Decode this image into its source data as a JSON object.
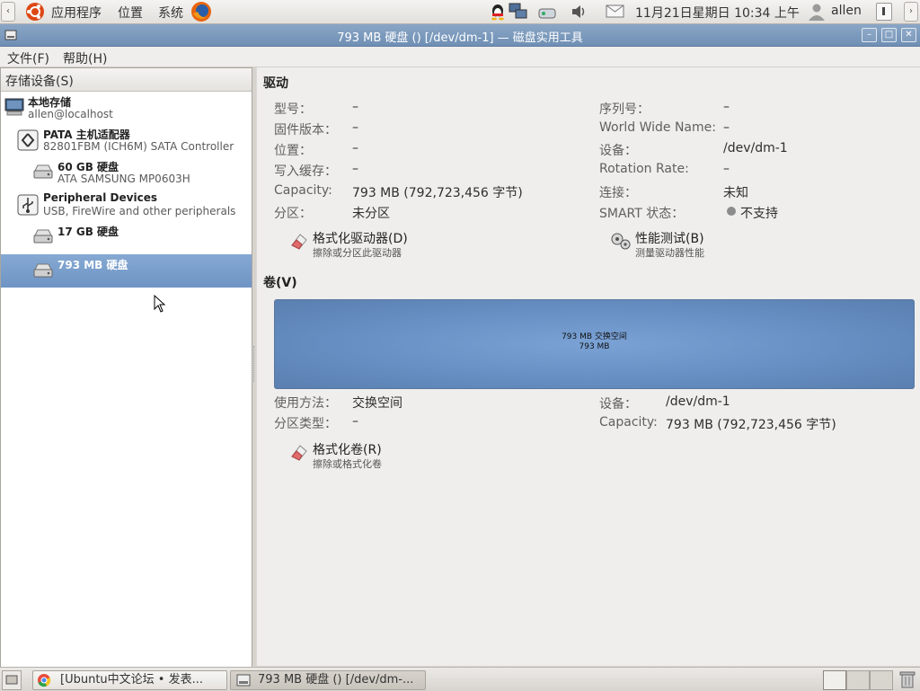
{
  "top_panel": {
    "menu_apps": "应用程序",
    "menu_places": "位置",
    "menu_system": "系统",
    "datetime": "11月21日星期日 10:34 上午",
    "user": "allen"
  },
  "window": {
    "title": "793 MB 硬盘 () [/dev/dm-1] — 磁盘实用工具"
  },
  "menubar": {
    "file": "文件(F)",
    "help": "帮助(H)"
  },
  "sidebar": {
    "header": "存储设备(S)",
    "items": [
      {
        "title": "本地存储",
        "subtitle": "allen@localhost"
      },
      {
        "title": "PATA 主机适配器",
        "subtitle": "82801FBM (ICH6M) SATA Controller"
      },
      {
        "title": "60 GB 硬盘",
        "subtitle": "ATA SAMSUNG MP0603H"
      },
      {
        "title": "Peripheral Devices",
        "subtitle": "USB, FireWire and other peripherals"
      },
      {
        "title": "17 GB 硬盘",
        "subtitle": ""
      },
      {
        "title": "793 MB 硬盘",
        "subtitle": ""
      }
    ]
  },
  "drive": {
    "header": "驱动",
    "model_label": "型号：",
    "model_value": "–",
    "firmware_label": "固件版本：",
    "firmware_value": "–",
    "location_label": "位置：",
    "location_value": "–",
    "cache_label": "写入缓存：",
    "cache_value": "–",
    "capacity_label": "Capacity:",
    "capacity_value": "793 MB (792,723,456 字节)",
    "partition_label": "分区：",
    "partition_value": "未分区",
    "serial_label": "序列号：",
    "serial_value": "–",
    "wwn_label": "World Wide Name:",
    "wwn_value": "–",
    "device_label": "设备：",
    "device_value": "/dev/dm-1",
    "rotation_label": "Rotation Rate:",
    "rotation_value": "–",
    "connection_label": "连接：",
    "connection_value": "未知",
    "smart_label": "SMART 状态：",
    "smart_value": "不支持",
    "format_title": "格式化驱动器(D)",
    "format_sub": "擦除或分区此驱动器",
    "bench_title": "性能测试(B)",
    "bench_sub": "测量驱动器性能"
  },
  "volume": {
    "header": "卷(V)",
    "bar_line1": "793 MB 交换空间",
    "bar_line2": "793 MB",
    "usage_label": "使用方法：",
    "usage_value": "交换空间",
    "ptype_label": "分区类型：",
    "ptype_value": "–",
    "device_label": "设备：",
    "device_value": "/dev/dm-1",
    "capacity_label": "Capacity:",
    "capacity_value": "793 MB (792,723,456 字节)",
    "format_title": "格式化卷(R)",
    "format_sub": "擦除或格式化卷"
  },
  "taskbar": {
    "task1": "[Ubuntu中文论坛 • 发表...",
    "task2": "793 MB 硬盘 () [/dev/dm-..."
  },
  "colors": {
    "titlebar": "#7f9cc0",
    "selection": "#7399c9",
    "volume_bar": "#6d95c9"
  }
}
